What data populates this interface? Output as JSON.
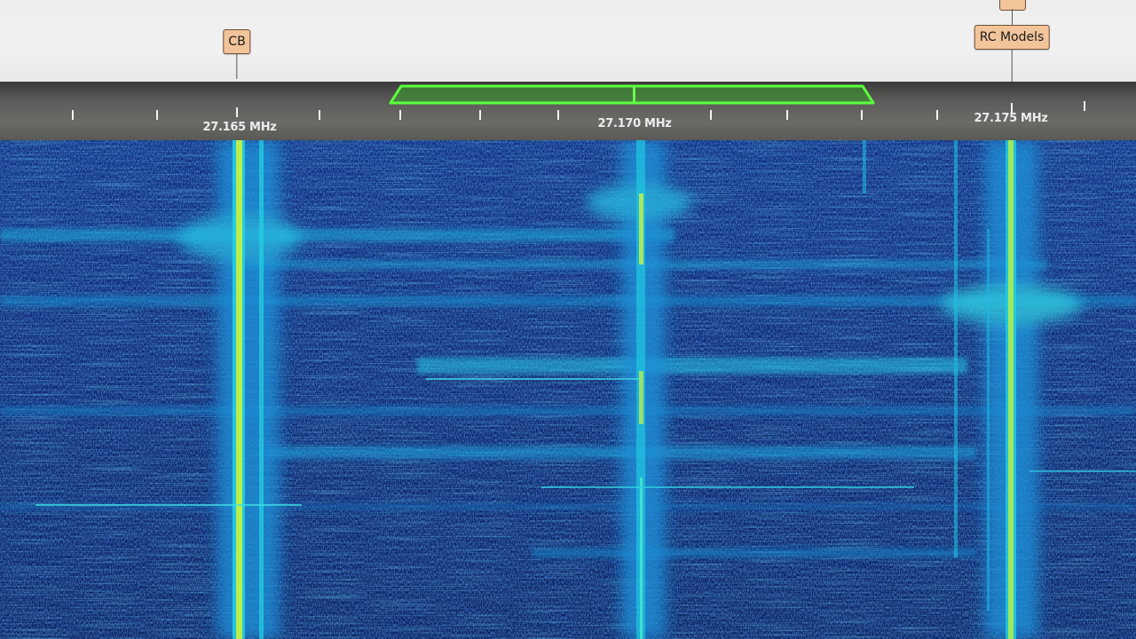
{
  "bookmarks": [
    {
      "id": "cb",
      "label": "CB"
    },
    {
      "id": "rc",
      "label": "RC Models"
    }
  ],
  "ruler": {
    "labels": [
      "27.165 MHz",
      "27.170 MHz",
      "27.175 MHz"
    ]
  },
  "colors": {
    "filter_window": "#55f23a",
    "bookmark_tag": "#f2c49a",
    "waterfall_base": "#0b215e",
    "signal_cyan": "#1fe0e8",
    "signal_yellow": "#cff25a"
  }
}
